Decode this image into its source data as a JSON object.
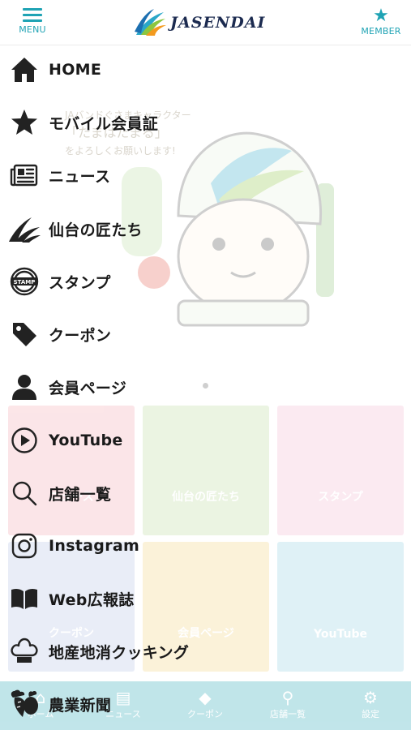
{
  "header": {
    "menu_label": "MENU",
    "brand": "JASENDAI",
    "member_label": "MEMBER",
    "accent_color": "#1fa3b4"
  },
  "background": {
    "hero_lines": [
      "JAバンドぐさまキャラクター",
      "「たまはたまる」",
      "をよろしくお願いします!"
    ],
    "tiles": [
      {
        "label": "ニュース",
        "color": "#f4a6ae",
        "icon": "news-icon"
      },
      {
        "label": "仙台の匠たち",
        "color": "#b9d89a",
        "icon": "leaf-icon"
      },
      {
        "label": "スタンプ",
        "color": "#f2b5cf",
        "icon": "stamp-icon"
      },
      {
        "label": "クーポン",
        "color": "#b3c1e6",
        "icon": "coupon-icon"
      },
      {
        "label": "会員ページ",
        "color": "#f3d27a",
        "icon": "person-icon"
      },
      {
        "label": "YouTube",
        "color": "#8fd0e0",
        "icon": "play-icon"
      }
    ],
    "tabs": [
      {
        "label": "ホーム",
        "icon": "home-icon"
      },
      {
        "label": "ニュース",
        "icon": "news-icon"
      },
      {
        "label": "クーポン",
        "icon": "coupon-icon"
      },
      {
        "label": "店舗一覧",
        "icon": "search-icon"
      },
      {
        "label": "設定",
        "icon": "gear-icon"
      }
    ]
  },
  "menu": {
    "items": [
      {
        "label": "HOME",
        "icon": "home-icon"
      },
      {
        "label": "モバイル会員証",
        "icon": "star-icon"
      },
      {
        "label": "ニュース",
        "icon": "newspaper-icon"
      },
      {
        "label": "仙台の匠たち",
        "icon": "leaf-logo-icon"
      },
      {
        "label": "スタンプ",
        "icon": "stamp-icon"
      },
      {
        "label": "クーポン",
        "icon": "tag-icon"
      },
      {
        "label": "会員ページ",
        "icon": "person-icon"
      },
      {
        "label": "YouTube",
        "icon": "play-circle-icon"
      },
      {
        "label": "店舗一覧",
        "icon": "search-icon"
      },
      {
        "label": "Instagram",
        "icon": "instagram-icon"
      },
      {
        "label": "Web広報誌",
        "icon": "book-icon"
      },
      {
        "label": "地産地消クッキング",
        "icon": "chef-hat-icon"
      },
      {
        "label": "農業新聞",
        "icon": "vegetables-icon"
      }
    ]
  }
}
